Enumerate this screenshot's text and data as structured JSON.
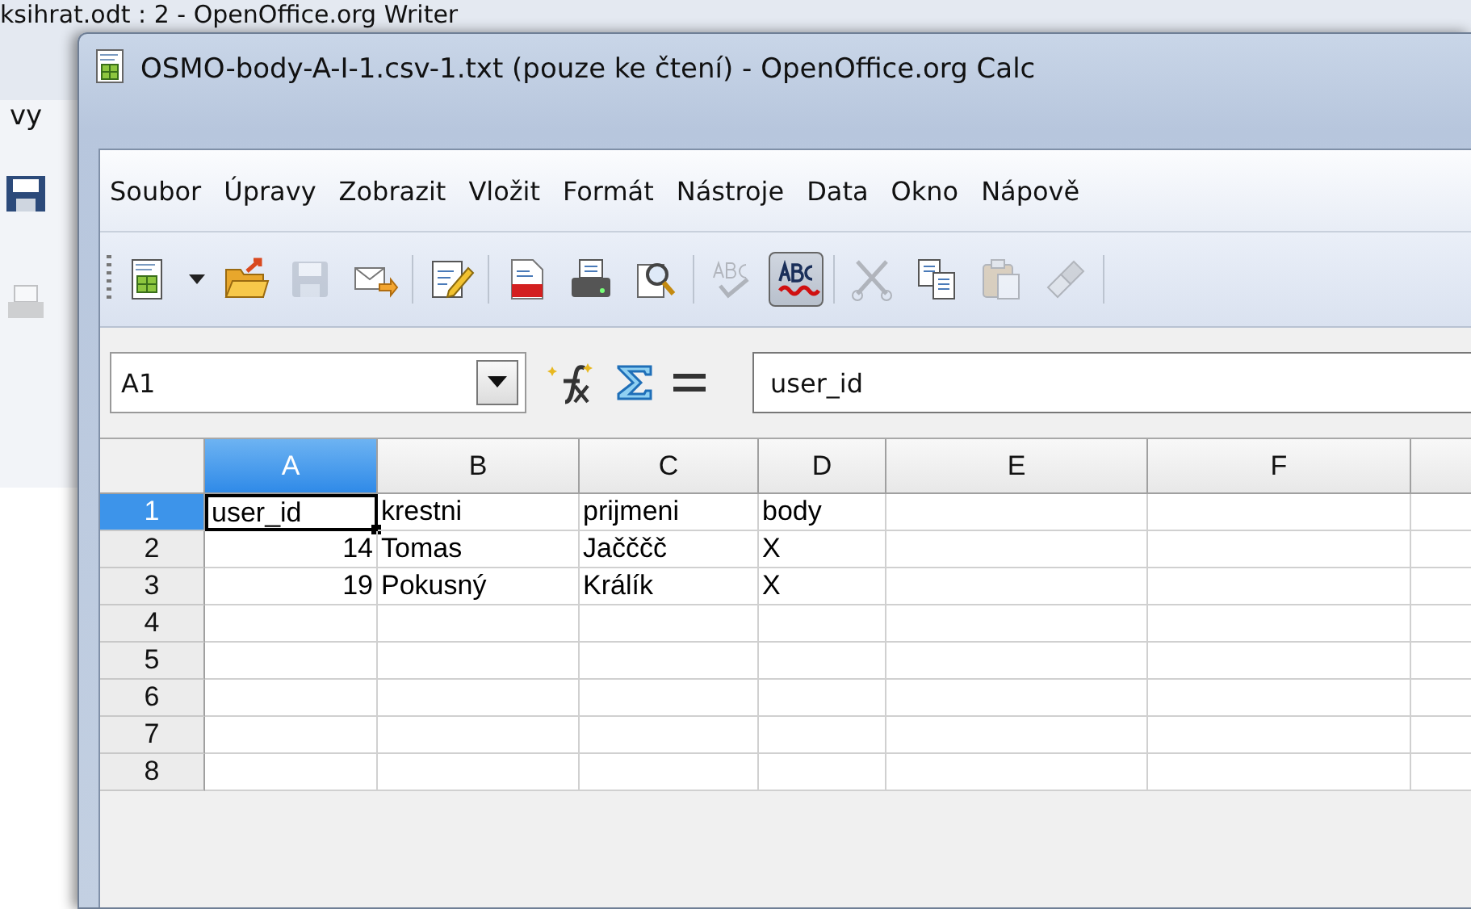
{
  "background_window": {
    "title": "ksihrat.odt : 2 - OpenOffice.org Writer",
    "menu_fragment": "vy"
  },
  "window": {
    "title": "OSMO-body-A-I-1.csv-1.txt (pouze ke čtení) - OpenOffice.org Calc"
  },
  "menu": [
    {
      "label": "Soubor"
    },
    {
      "label": "Úpravy"
    },
    {
      "label": "Zobrazit"
    },
    {
      "label": "Vložit"
    },
    {
      "label": "Formát"
    },
    {
      "label": "Nástroje"
    },
    {
      "label": "Data"
    },
    {
      "label": "Okno"
    },
    {
      "label": "Nápově"
    }
  ],
  "toolbar": [
    {
      "kind": "new",
      "disabled": false,
      "pressed": false
    },
    {
      "kind": "dropdown",
      "disabled": false,
      "pressed": false
    },
    {
      "kind": "open",
      "disabled": false,
      "pressed": false
    },
    {
      "kind": "save",
      "disabled": true,
      "pressed": false
    },
    {
      "kind": "email",
      "disabled": false,
      "pressed": false
    },
    {
      "kind": "separator"
    },
    {
      "kind": "edit",
      "disabled": false,
      "pressed": false
    },
    {
      "kind": "separator"
    },
    {
      "kind": "pdf",
      "disabled": false,
      "pressed": false
    },
    {
      "kind": "print",
      "disabled": false,
      "pressed": false
    },
    {
      "kind": "preview",
      "disabled": false,
      "pressed": false
    },
    {
      "kind": "separator"
    },
    {
      "kind": "spellcheck",
      "disabled": true,
      "pressed": false
    },
    {
      "kind": "autospell",
      "disabled": false,
      "pressed": true
    },
    {
      "kind": "separator"
    },
    {
      "kind": "cut",
      "disabled": true,
      "pressed": false
    },
    {
      "kind": "copy",
      "disabled": false,
      "pressed": false
    },
    {
      "kind": "paste",
      "disabled": true,
      "pressed": false
    },
    {
      "kind": "brush",
      "disabled": true,
      "pressed": false
    },
    {
      "kind": "separator"
    }
  ],
  "formula_bar": {
    "name_box": "A1",
    "input": "user_id"
  },
  "sheet": {
    "columns": [
      {
        "label": "A",
        "selected": true
      },
      {
        "label": "B",
        "selected": false
      },
      {
        "label": "C",
        "selected": false
      },
      {
        "label": "D",
        "selected": false
      },
      {
        "label": "E",
        "selected": false
      },
      {
        "label": "F",
        "selected": false
      }
    ],
    "rows": [
      {
        "header": "1",
        "selected": true,
        "cells": [
          {
            "text": "user_id",
            "kind": "text",
            "selected": true
          },
          {
            "text": "krestni",
            "kind": "text",
            "selected": false
          },
          {
            "text": "prijmeni",
            "kind": "text",
            "selected": false
          },
          {
            "text": "body",
            "kind": "text",
            "selected": false
          }
        ]
      },
      {
        "header": "2",
        "selected": false,
        "cells": [
          {
            "text": "14",
            "kind": "number",
            "selected": false
          },
          {
            "text": "Tomas",
            "kind": "text",
            "selected": false
          },
          {
            "text": "Jačččč",
            "kind": "text",
            "selected": false
          },
          {
            "text": "X",
            "kind": "text",
            "selected": false
          }
        ]
      },
      {
        "header": "3",
        "selected": false,
        "cells": [
          {
            "text": "19",
            "kind": "number",
            "selected": false
          },
          {
            "text": "Pokusný",
            "kind": "text",
            "selected": false
          },
          {
            "text": "Králík",
            "kind": "text",
            "selected": false
          },
          {
            "text": "X",
            "kind": "text",
            "selected": false
          }
        ]
      },
      {
        "header": "4",
        "selected": false,
        "cells": []
      },
      {
        "header": "5",
        "selected": false,
        "cells": []
      },
      {
        "header": "6",
        "selected": false,
        "cells": []
      },
      {
        "header": "7",
        "selected": false,
        "cells": []
      },
      {
        "header": "8",
        "selected": false,
        "cells": []
      }
    ]
  }
}
